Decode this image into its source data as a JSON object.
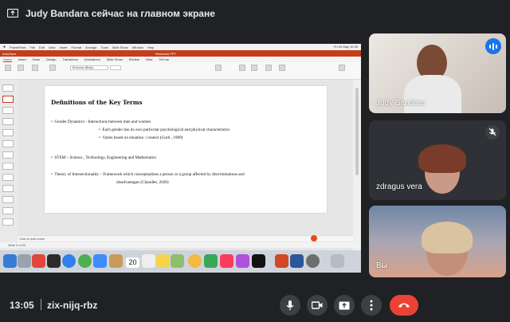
{
  "meet": {
    "presenting_banner": "Judy Bandara сейчас на главном экране",
    "meeting_time": "13:05",
    "meeting_code": "zix-nijq-rbz",
    "participants": [
      {
        "name": "Judy Bandara",
        "speaking": true
      },
      {
        "name": "zdragus vera",
        "muted": true
      },
      {
        "name": "Вы"
      }
    ],
    "controls": {
      "mic_icon": "microphone-icon",
      "camera_icon": "camera-icon",
      "present_icon": "present-screen-icon",
      "more_icon": "more-vert-icon",
      "end_icon": "end-call-icon"
    },
    "colors": {
      "end_call": "#ea4335",
      "speaking": "#1a73e8",
      "background": "#202124"
    }
  },
  "shared_screen": {
    "mac_menu": [
      "PowerPoint",
      "File",
      "Edit",
      "View",
      "Insert",
      "Format",
      "Arrange",
      "Tools",
      "Slide Show",
      "Window",
      "Help"
    ],
    "mac_clock": "Fri 20 May 10:35",
    "ppt_autosave": "AutoSave",
    "ppt_doc_title": "Research PPT",
    "ribbon_tabs": [
      "Home",
      "Insert",
      "Draw",
      "Design",
      "Transitions",
      "Animations",
      "Slide Show",
      "Review",
      "View",
      "Tell me"
    ],
    "active_tab": "Home",
    "ribbon_font": "Bookman (Body)",
    "slide": {
      "title": "Definitions of the Key Terms",
      "lines": [
        "Gender Dynamics   -  Interactions between men and women",
        "Each gender has its own particular psychological and physical characteristics",
        "Varies based on situation / context  (Gurli , 1989)",
        "STEM – Science , Technology, Engineering and Mathematics",
        "Theory of Intersectionality – Framework which conceptualizes a person or a group affected by discriminations and",
        "disadvantages (Chandler, 2020)"
      ]
    },
    "notes_placeholder": "Click to add notes",
    "status_text": "Slide 3 of 20",
    "dock_date": "20"
  }
}
